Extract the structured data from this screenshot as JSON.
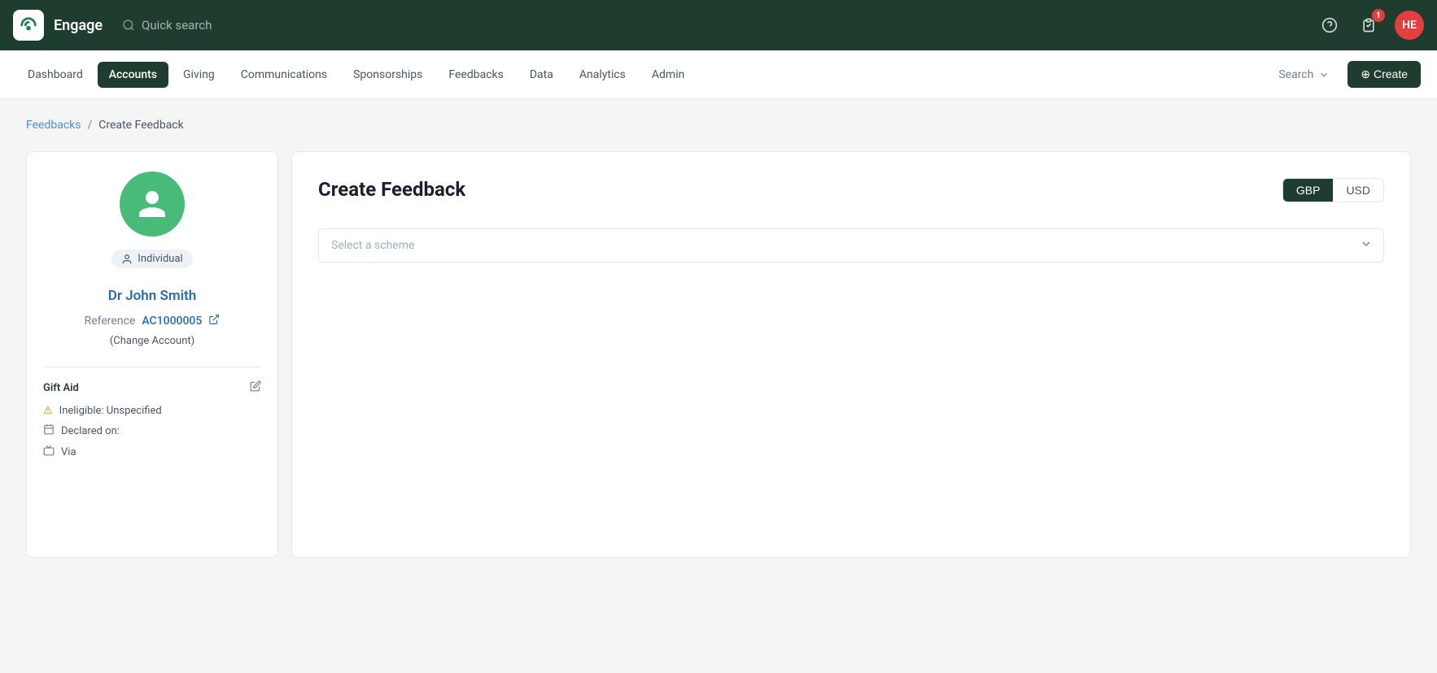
{
  "app": {
    "name": "Engage",
    "logo_text": "↗"
  },
  "topbar": {
    "quick_search_placeholder": "Quick search",
    "help_icon": "help-circle",
    "tasks_icon": "clipboard",
    "tasks_badge": "1",
    "avatar_initials": "HE"
  },
  "nav": {
    "items": [
      {
        "label": "Dashboard",
        "active": false
      },
      {
        "label": "Accounts",
        "active": true
      },
      {
        "label": "Giving",
        "active": false
      },
      {
        "label": "Communications",
        "active": false
      },
      {
        "label": "Sponsorships",
        "active": false
      },
      {
        "label": "Feedbacks",
        "active": false
      },
      {
        "label": "Data",
        "active": false
      },
      {
        "label": "Analytics",
        "active": false
      },
      {
        "label": "Admin",
        "active": false
      }
    ],
    "search_label": "Search",
    "create_label": "+ Create"
  },
  "breadcrumb": {
    "parent_label": "Feedbacks",
    "current_label": "Create Feedback",
    "separator": "/"
  },
  "sidebar": {
    "account_type": "Individual",
    "account_name": "Dr John Smith",
    "reference_label": "Reference",
    "reference_value": "AC1000005",
    "change_account_label": "(Change Account)",
    "gift_aid_section": "Gift Aid",
    "gift_aid_status": "Ineligible: Unspecified",
    "declared_on_label": "Declared on:",
    "via_label": "Via"
  },
  "form": {
    "title": "Create Feedback",
    "currency_gbp": "GBP",
    "currency_usd": "USD",
    "scheme_placeholder": "Select a scheme"
  }
}
